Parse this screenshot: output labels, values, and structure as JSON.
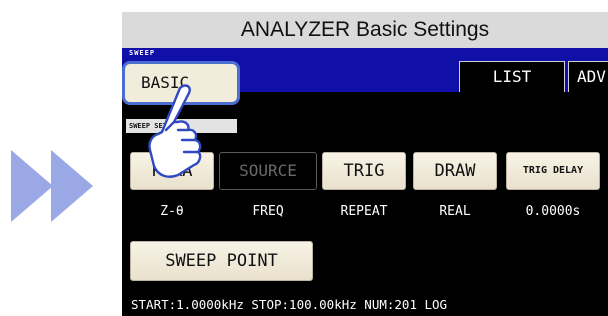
{
  "header": {
    "title": "ANALYZER Basic Settings"
  },
  "mode_label": "SWEEP",
  "tabs": {
    "basic": "BASIC",
    "list": "LIST",
    "adv": "ADV"
  },
  "section_label": "SWEEP SETUP",
  "buttons": {
    "para": "PARA",
    "source": "SOURCE",
    "trig": "TRIG",
    "draw": "DRAW",
    "trig_delay": "TRIG DELAY",
    "sweep_point": "SWEEP POINT"
  },
  "values": {
    "para": "Z-θ",
    "source": "FREQ",
    "trig": "REPEAT",
    "draw": "REAL",
    "trig_delay": "0.0000s"
  },
  "status_line": "START:1.0000kHz STOP:100.00kHz NUM:201 LOG",
  "colors": {
    "tab_bar": "#1010a8",
    "button_face": "#f2ecdd",
    "highlight_border": "#4a6fd0",
    "arrow": "#9aa8e6",
    "screen_bg": "#000000"
  },
  "icons": {
    "arrows": "double-chevron-right-icon",
    "pointer": "pointing-hand-icon"
  }
}
